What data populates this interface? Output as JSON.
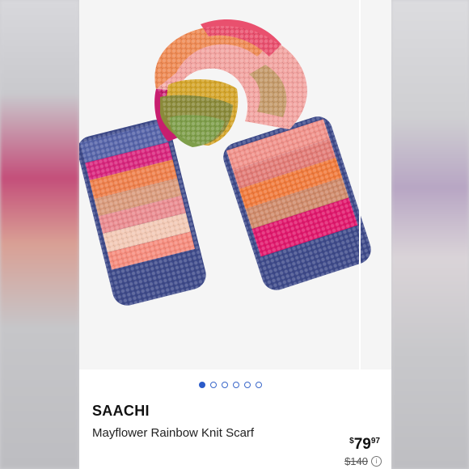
{
  "product": {
    "brand": "SAACHI",
    "title": "Mayflower Rainbow Knit Scarf",
    "price_currency": "$",
    "price_main": "79",
    "price_cents": "97",
    "original_price": "$140",
    "info_icon": "info-icon",
    "image_subject": "scarf-image"
  },
  "carousel": {
    "count": 6,
    "active_index": 0
  },
  "colors": {
    "accent": "#2b5bc9",
    "card_bg": "#ffffff",
    "image_bg": "#f5f5f5"
  }
}
